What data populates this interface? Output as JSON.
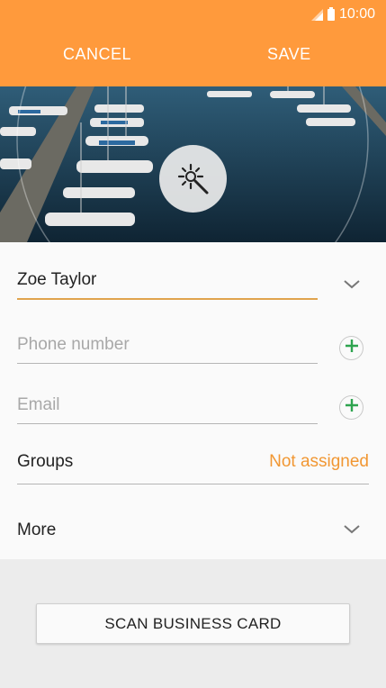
{
  "status_bar": {
    "time": "10:00",
    "icons": [
      "signal-icon",
      "battery-icon"
    ]
  },
  "header": {
    "cancel_label": "CANCEL",
    "save_label": "SAVE",
    "background": "#ff9a3c"
  },
  "photo": {
    "description_icon": "magic-wand-icon"
  },
  "form": {
    "name": {
      "value": "Zoe Taylor"
    },
    "phone": {
      "placeholder": "Phone number"
    },
    "email": {
      "placeholder": "Email"
    },
    "groups": {
      "label": "Groups",
      "value": "Not assigned"
    },
    "more": {
      "label": "More"
    }
  },
  "scan_button": {
    "label": "SCAN BUSINESS CARD"
  },
  "colors": {
    "accent": "#f19733",
    "add_icon": "#2ea44f",
    "active_underline": "#e0a44d"
  }
}
